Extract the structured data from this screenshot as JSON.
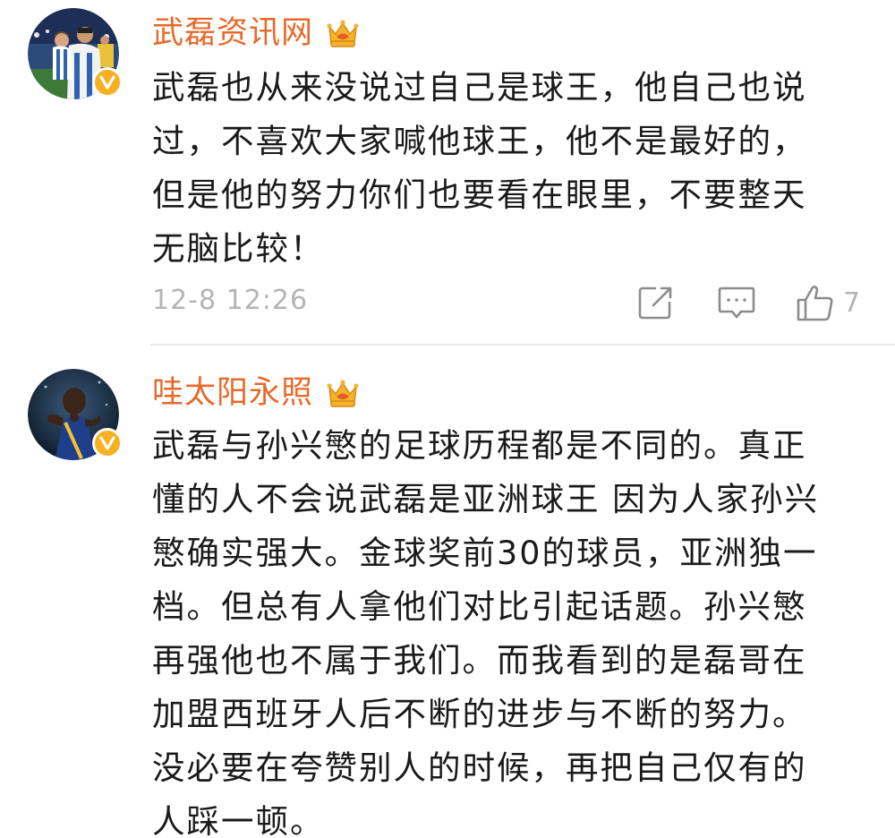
{
  "comments": [
    {
      "username": "武磊资讯网",
      "content": "武磊也从来没说过自己是球王，他自己也说\n过，不喜欢大家喊他球王，他不是最好的，\n但是他的努力你们也要看在眼里，不要整天\n无脑比较！",
      "timestamp": "12-8 12:26",
      "likes": "7",
      "verified_color": "#f7b022",
      "username_color": "#e8692a"
    },
    {
      "username": "哇太阳永照",
      "content": "武磊与孙兴慜的足球历程都是不同的。真正\n懂的人不会说武磊是亚洲球王 因为人家孙兴\n慜确实强大。金球奖前30的球员，亚洲独一\n档。但总有人拿他们对比引起话题。孙兴慜\n再强他也不属于我们。而我看到的是磊哥在\n加盟西班牙人后不断的进步与不断的努力。\n没必要在夸赞别人的时候，再把自己仅有的\n人踩一顿。",
      "verified_color": "#f7b022",
      "username_color": "#e8692a"
    }
  ],
  "icons": {
    "crown": "crown-icon",
    "verified": "verified-v-icon",
    "share": "share-edit-icon",
    "comment": "comment-icon",
    "like": "thumbs-up-icon"
  }
}
